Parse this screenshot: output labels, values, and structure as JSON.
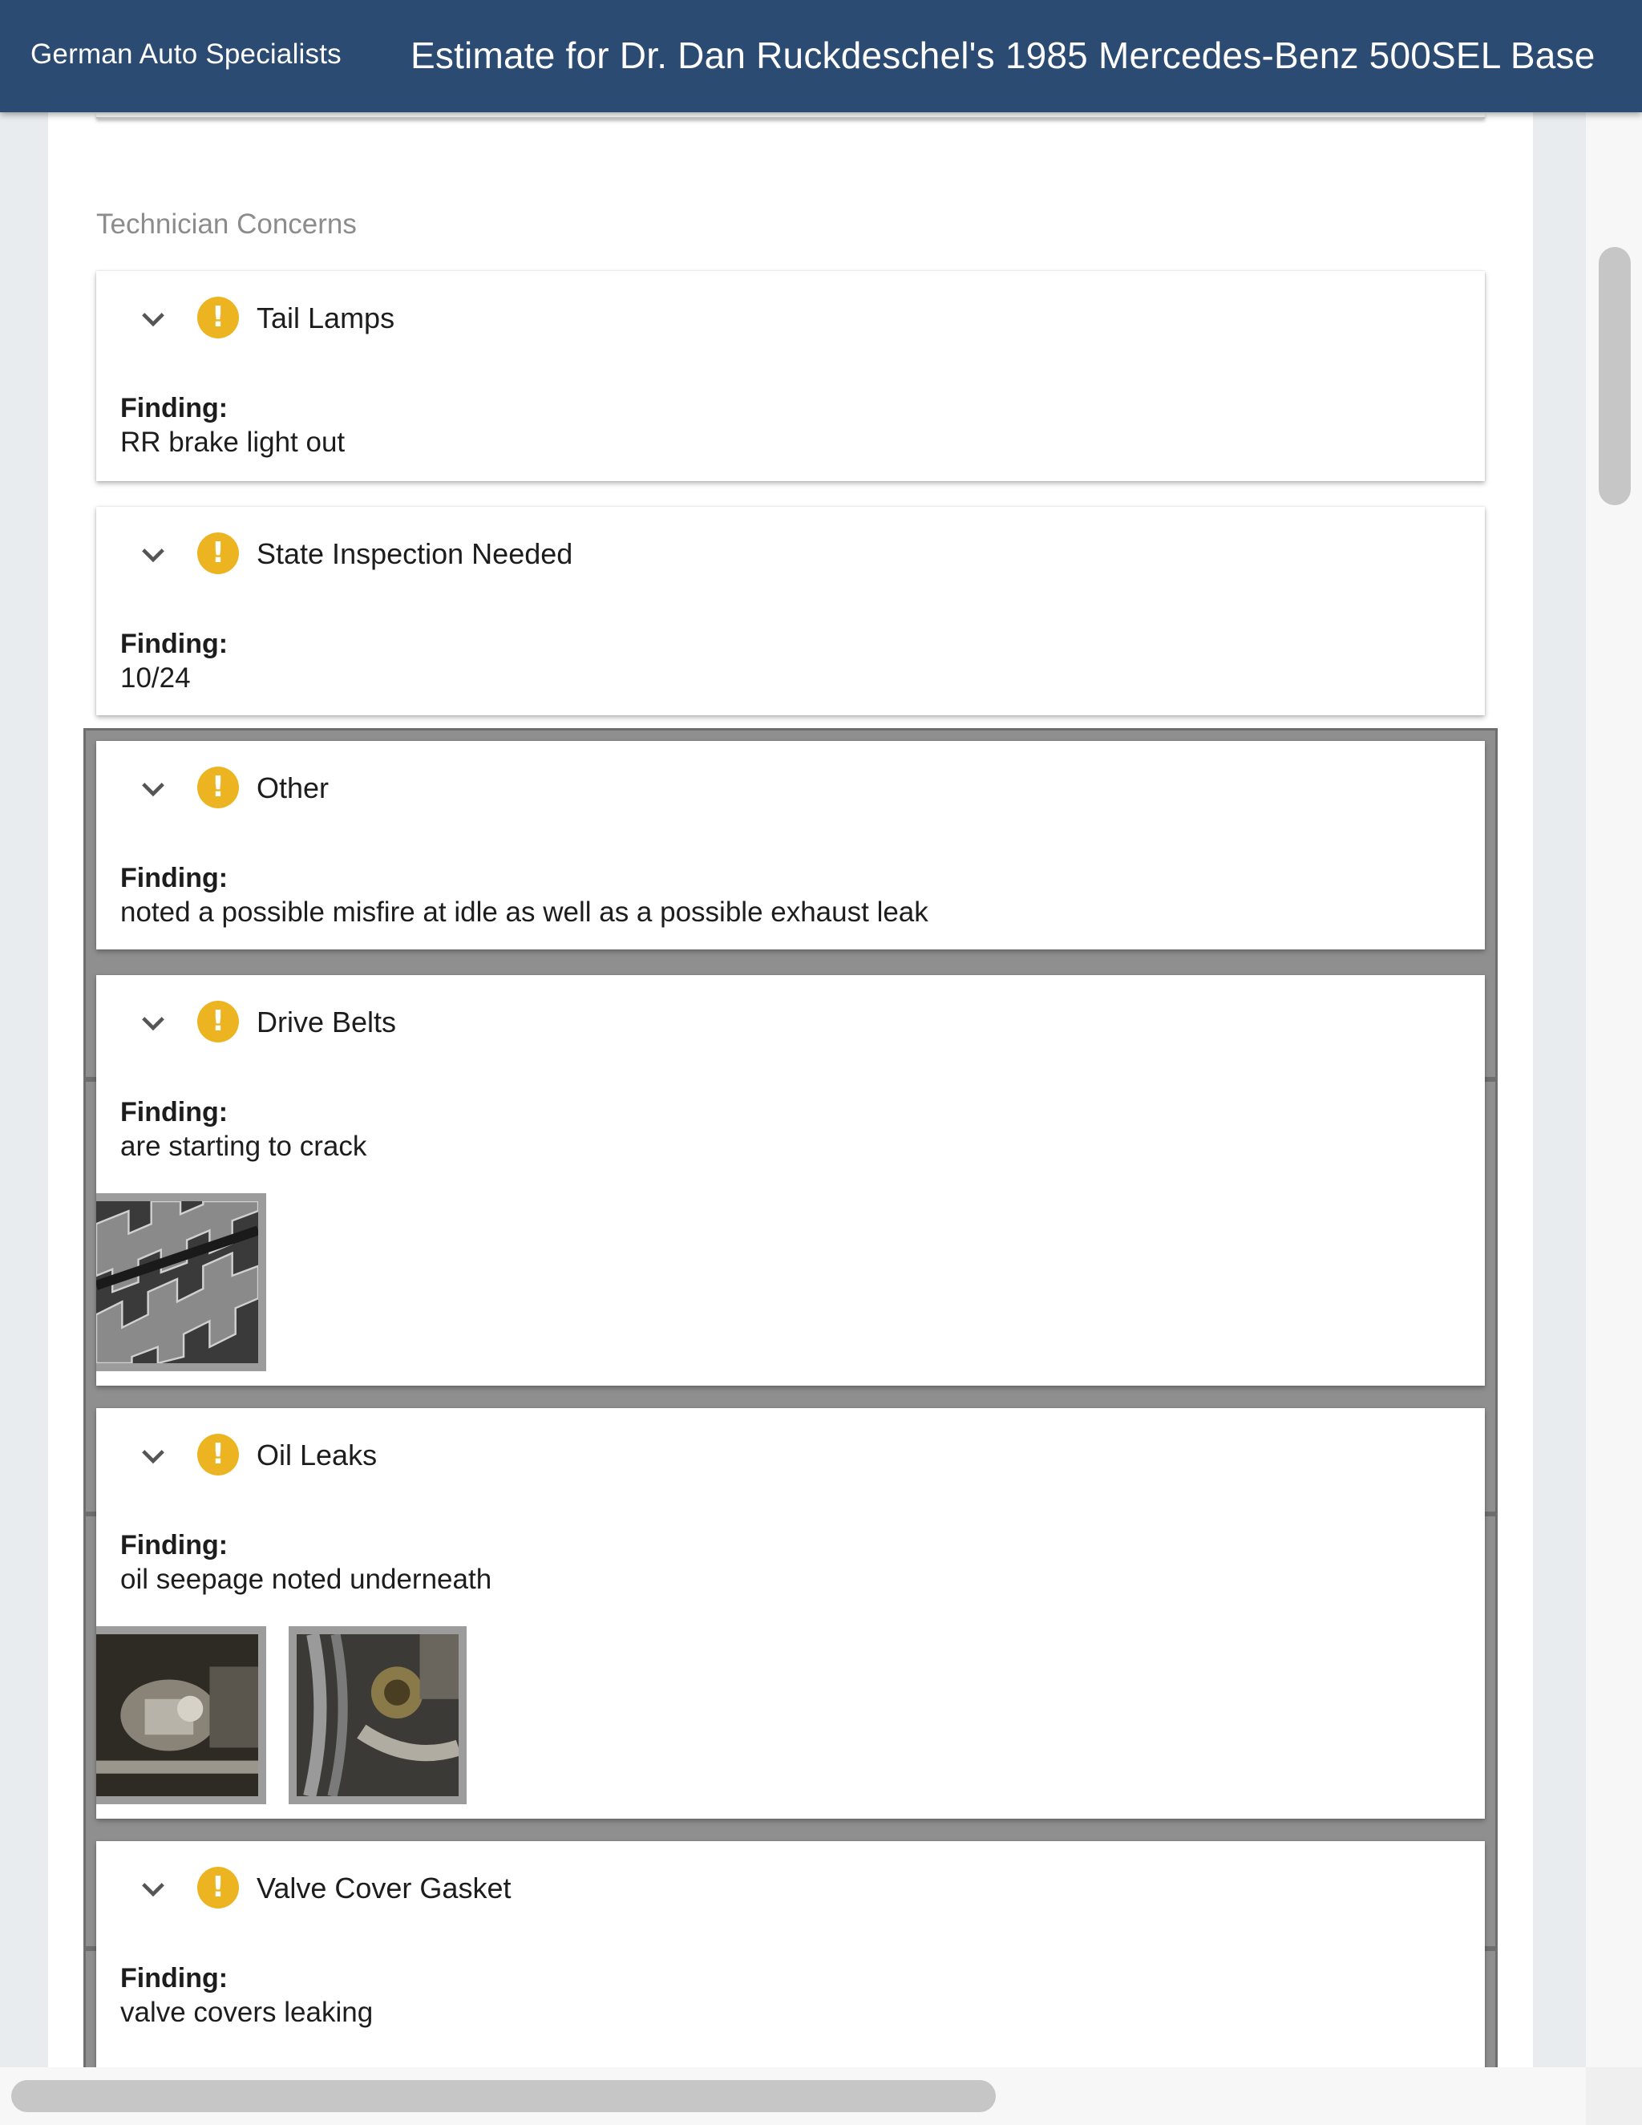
{
  "header": {
    "shop_name": "German Auto Specialists",
    "title": "Estimate for Dr. Dan Ruckdeschel's 1985 Mercedes-Benz 500SEL Base"
  },
  "section": {
    "heading": "Technician Concerns"
  },
  "finding_label": "Finding:",
  "colors": {
    "header_bg": "#2c4b72",
    "warning": "#ecb421",
    "selected_frame": "#8f8f8f"
  },
  "concerns": [
    {
      "title": "Tail Lamps",
      "finding": "RR brake light out",
      "photos": 0,
      "icon": "warning-icon",
      "selected": false
    },
    {
      "title": "State Inspection Needed",
      "finding": "10/24",
      "photos": 0,
      "icon": "warning-icon",
      "selected": false
    },
    {
      "title": "Other",
      "finding": "noted a possible misfire at idle as well as a possible exhaust leak",
      "photos": 0,
      "icon": "warning-icon",
      "selected": true
    },
    {
      "title": "Drive Belts",
      "finding": "are starting to crack",
      "photos": 1,
      "icon": "warning-icon",
      "selected": true
    },
    {
      "title": "Oil Leaks",
      "finding": "oil seepage noted underneath",
      "photos": 2,
      "icon": "warning-icon",
      "selected": true
    },
    {
      "title": "Valve Cover Gasket",
      "finding": "valve covers leaking",
      "photos": 0,
      "icon": "warning-icon",
      "selected": true
    }
  ]
}
